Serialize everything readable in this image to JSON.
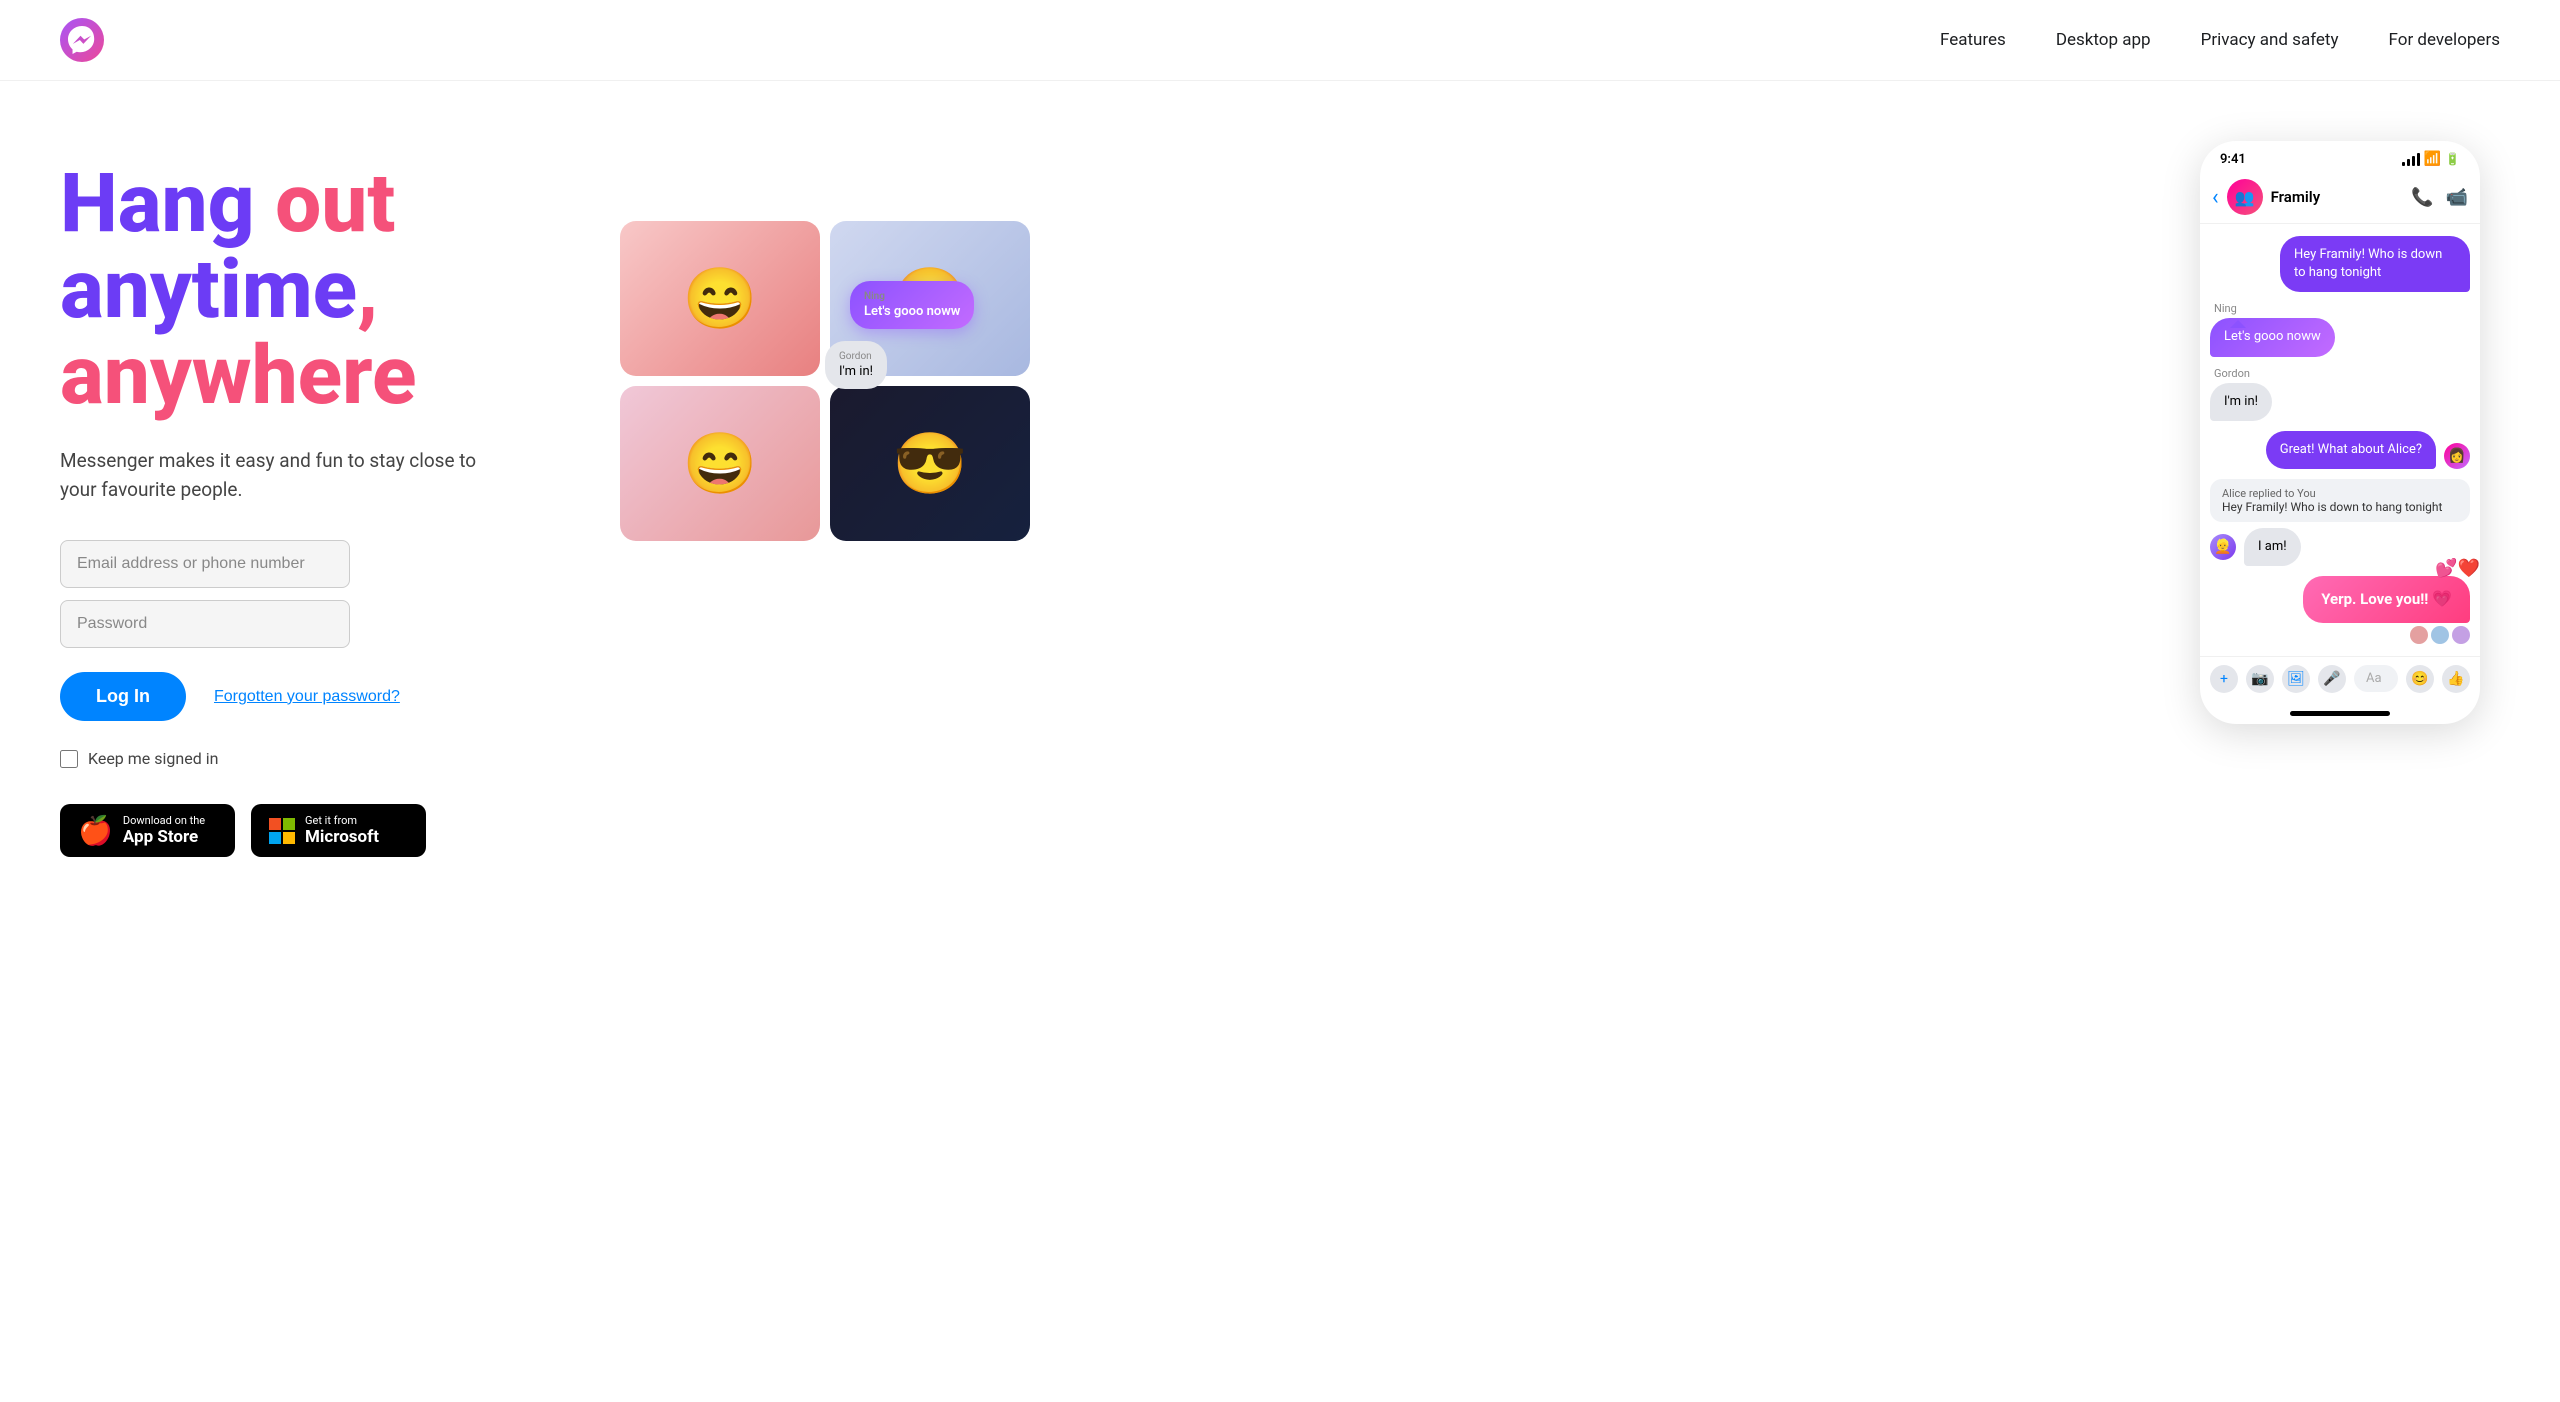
{
  "header": {
    "logo_alt": "Messenger logo",
    "nav": {
      "features": "Features",
      "desktop_app": "Desktop app",
      "privacy_safety": "Privacy and safety",
      "for_developers": "For developers"
    }
  },
  "hero": {
    "line1_word1": "Hang",
    "line1_word2": "out",
    "line2_word1": "anytime,",
    "line3_word1": "anywhere",
    "subtitle": "Messenger makes it easy and fun to stay close to your favourite people."
  },
  "form": {
    "email_placeholder": "Email address or phone number",
    "password_placeholder": "Password",
    "login_label": "Log In",
    "forgot_label": "Forgotten your password?",
    "keep_signed_label": "Keep me signed in"
  },
  "downloads": {
    "app_store_sub": "Download on the",
    "app_store_main": "App Store",
    "microsoft_sub": "Get it from",
    "microsoft_main": "Microsoft"
  },
  "chat_demo": {
    "status_time": "9:41",
    "group_name": "Framily",
    "messages": [
      {
        "dir": "right",
        "text": "Hey Framily! Who is down to hang tonight"
      },
      {
        "dir": "left",
        "sender": "Ning",
        "text": "Let's gooo noww"
      },
      {
        "dir": "left",
        "sender": "Gordon",
        "text": "I'm in!"
      },
      {
        "dir": "right",
        "text": "Great! What about Alice?"
      },
      {
        "dir": "left",
        "text": "I am!"
      },
      {
        "dir": "right",
        "text": "Yerp. Love you!!"
      }
    ],
    "reply_label": "Alice replied to You",
    "reply_preview": "Hey Framily! Who is down to hang tonight",
    "input_placeholder": "Aa"
  }
}
